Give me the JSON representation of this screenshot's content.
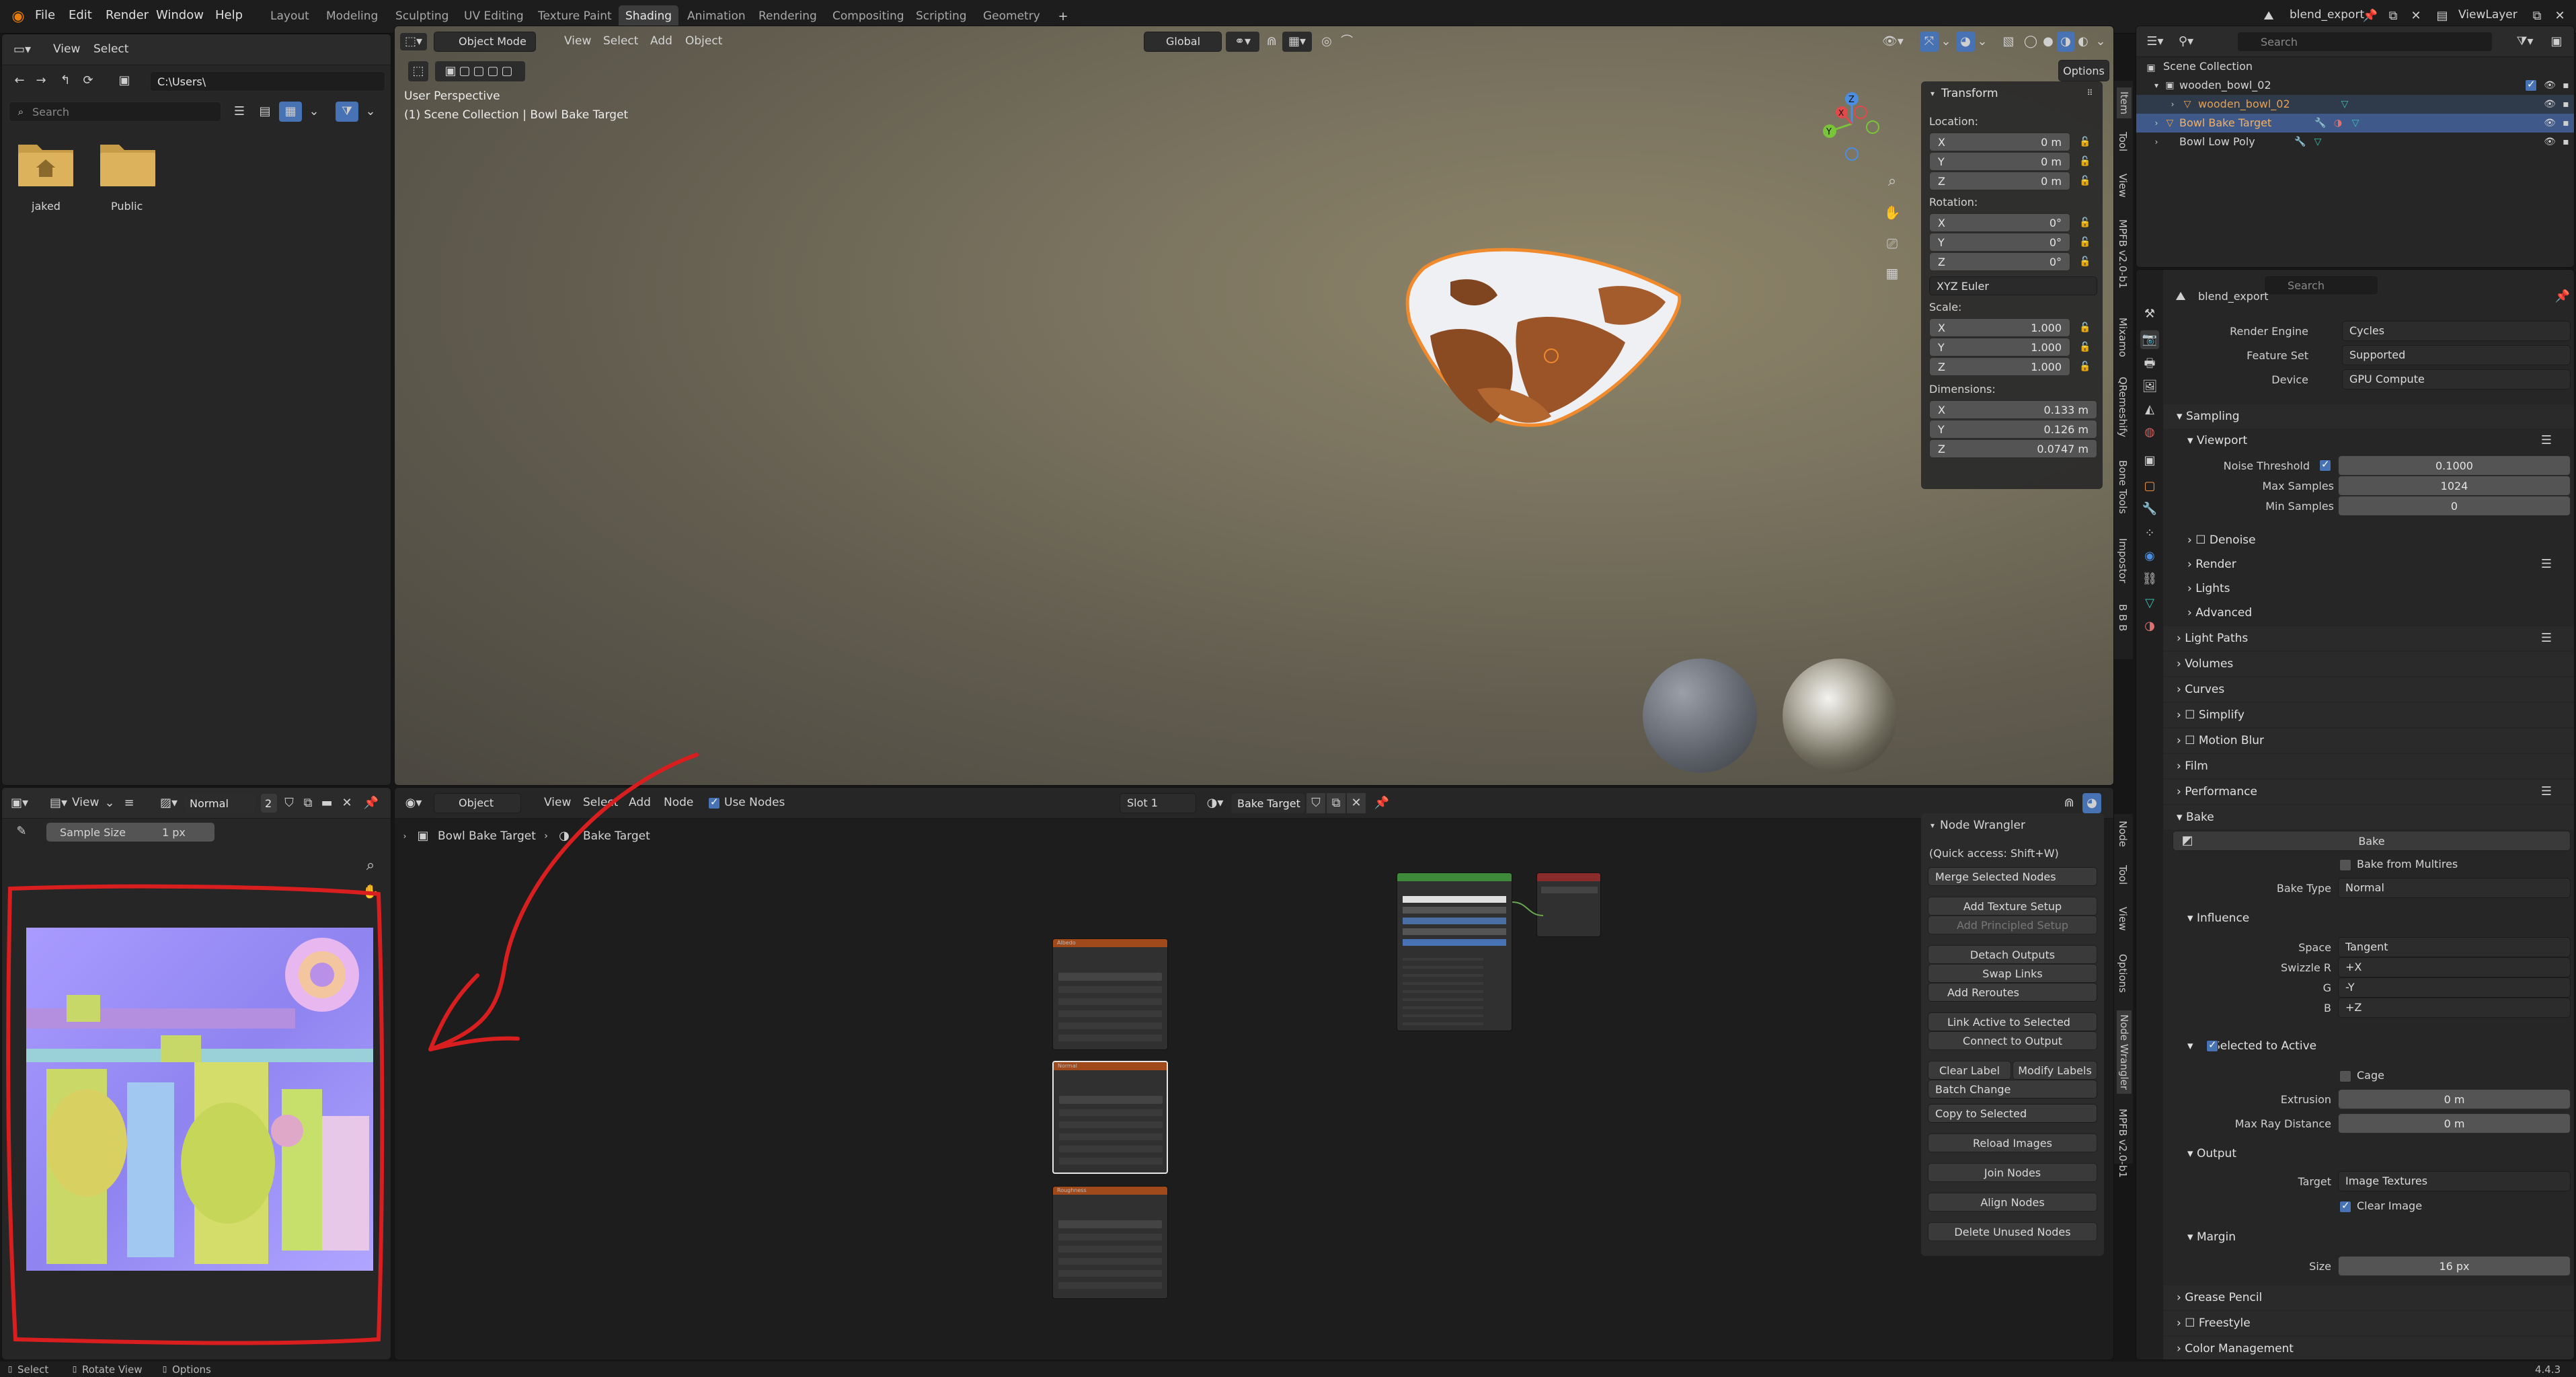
{
  "top_menu": [
    "File",
    "Edit",
    "Render",
    "Window",
    "Help"
  ],
  "workspaces": [
    "Layout",
    "Modeling",
    "Sculpting",
    "UV Editing",
    "Texture Paint",
    "Shading",
    "Animation",
    "Rendering",
    "Compositing",
    "Scripting",
    "Geometry"
  ],
  "active_workspace": "Shading",
  "scene_name": "blend_export",
  "view_layer": "ViewLayer",
  "file_browser": {
    "menus": [
      "View",
      "Select"
    ],
    "path": "C:\\Users\\",
    "search_placeholder": "Search",
    "folders": [
      "jaked",
      "Public"
    ]
  },
  "viewport": {
    "mode": "Object Mode",
    "menus": [
      "View",
      "Select",
      "Add",
      "Object"
    ],
    "orientation": "Global",
    "options_label": "Options",
    "perspective": "User Perspective",
    "collection_info": "(1) Scene Collection | Bowl Bake Target",
    "transform": {
      "title": "Transform",
      "location_label": "Location:",
      "location": {
        "x": "0 m",
        "y": "0 m",
        "z": "0 m"
      },
      "rotation_label": "Rotation:",
      "rotation": {
        "x": "0°",
        "y": "0°",
        "z": "0°"
      },
      "rotation_mode": "XYZ Euler",
      "scale_label": "Scale:",
      "scale": {
        "x": "1.000",
        "y": "1.000",
        "z": "1.000"
      },
      "dimensions_label": "Dimensions:",
      "dimensions": {
        "x": "0.133 m",
        "y": "0.126 m",
        "z": "0.0747 m"
      }
    },
    "side_tabs": [
      "Item",
      "Tool",
      "View",
      "MPFB v2.0-b1",
      "Mixamo",
      "QRemeshify",
      "Bone Tools",
      "Impostor",
      "B B B"
    ]
  },
  "image_editor": {
    "view_label": "View",
    "image_name": "Normal",
    "user_count": "2",
    "sample_label": "Sample Size",
    "sample_value": "1 px"
  },
  "node_editor": {
    "type": "Object",
    "menus": [
      "View",
      "Select",
      "Add",
      "Node"
    ],
    "use_nodes_label": "Use Nodes",
    "slot": "Slot 1",
    "material": "Bake Target",
    "breadcrumb_object": "Bowl Bake Target",
    "breadcrumb_material": "Bake Target",
    "side_tabs": [
      "Node",
      "Tool",
      "View",
      "Options",
      "Node Wrangler",
      "MPFB v2.0-b1"
    ],
    "image_nodes": [
      "Albedo",
      "Normal",
      "Roughness"
    ]
  },
  "node_wrangler": {
    "title": "Node Wrangler",
    "hint": "(Quick access: Shift+W)",
    "merge": "Merge Selected Nodes",
    "add_texture_setup": "Add Texture Setup",
    "add_principled_setup": "Add Principled Setup",
    "detach_outputs": "Detach Outputs",
    "swap_links": "Swap Links",
    "add_reroutes": "Add Reroutes",
    "link_active": "Link Active to Selected",
    "connect_output": "Connect to Output",
    "clear_label": "Clear Label",
    "modify_labels": "Modify Labels",
    "batch_change": "Batch Change",
    "copy_selected": "Copy to Selected",
    "reload_images": "Reload Images",
    "join_nodes": "Join Nodes",
    "align_nodes": "Align Nodes",
    "delete_unused": "Delete Unused Nodes"
  },
  "outliner": {
    "search_placeholder": "Search",
    "root": "Scene Collection",
    "items": [
      {
        "name": "wooden_bowl_02"
      },
      {
        "name": "wooden_bowl_02"
      },
      {
        "name": "Bowl Bake Target"
      },
      {
        "name": "Bowl Low Poly"
      }
    ]
  },
  "properties": {
    "search_placeholder": "Search",
    "scene": "blend_export",
    "render_engine_label": "Render Engine",
    "render_engine": "Cycles",
    "feature_set_label": "Feature Set",
    "feature_set": "Supported",
    "device_label": "Device",
    "device": "GPU Compute",
    "sampling": "Sampling",
    "viewport": "Viewport",
    "noise_threshold_label": "Noise Threshold",
    "noise_threshold": "0.1000",
    "max_samples_label": "Max Samples",
    "max_samples": "1024",
    "min_samples_label": "Min Samples",
    "min_samples": "0",
    "denoise": "Denoise",
    "render": "Render",
    "lights": "Lights",
    "advanced": "Advanced",
    "light_paths": "Light Paths",
    "volumes": "Volumes",
    "curves": "Curves",
    "simplify": "Simplify",
    "motion_blur": "Motion Blur",
    "film": "Film",
    "performance": "Performance",
    "bake": "Bake",
    "bake_button": "Bake",
    "bake_from_multires": "Bake from Multires",
    "bake_type_label": "Bake Type",
    "bake_type": "Normal",
    "influence": "Influence",
    "space_label": "Space",
    "space": "Tangent",
    "swizzle_r_label": "Swizzle R",
    "swizzle_r": "+X",
    "g_label": "G",
    "g": "-Y",
    "b_label": "B",
    "b": "+Z",
    "selected_to_active": "Selected to Active",
    "cage": "Cage",
    "extrusion_label": "Extrusion",
    "extrusion": "0 m",
    "max_ray_label": "Max Ray Distance",
    "max_ray": "0 m",
    "output": "Output",
    "target_label": "Target",
    "target": "Image Textures",
    "clear_image": "Clear Image",
    "margin": "Margin",
    "size_label": "Size",
    "size": "16 px",
    "grease_pencil": "Grease Pencil",
    "freestyle": "Freestyle",
    "color_management": "Color Management"
  },
  "status_bar": {
    "select": "Select",
    "rotate_view": "Rotate View",
    "options": "Options",
    "version": "4.4.3"
  }
}
